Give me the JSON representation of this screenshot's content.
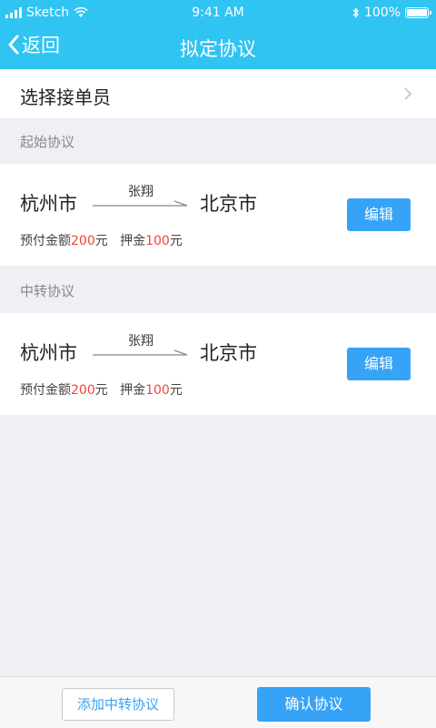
{
  "status_bar": {
    "carrier": "Sketch",
    "time": "9:41 AM",
    "battery": "100%"
  },
  "nav": {
    "back_label": "返回",
    "title": "拟定协议"
  },
  "select_row": {
    "label": "选择接单员"
  },
  "sections": [
    {
      "title": "起始协议",
      "from": "杭州市",
      "driver": "张翔",
      "to": "北京市",
      "prepaid_label": "预付金额",
      "prepaid_value": "200",
      "prepaid_unit": "元",
      "deposit_label": "押金",
      "deposit_value": "100",
      "deposit_unit": "元",
      "edit_label": "编辑"
    },
    {
      "title": "中转协议",
      "from": "杭州市",
      "driver": "张翔",
      "to": "北京市",
      "prepaid_label": "预付金额",
      "prepaid_value": "200",
      "prepaid_unit": "元",
      "deposit_label": "押金",
      "deposit_value": "100",
      "deposit_unit": "元",
      "edit_label": "编辑"
    }
  ],
  "footer": {
    "add_label": "添加中转协议",
    "confirm_label": "确认协议"
  },
  "colors": {
    "header": "#2fc4f2",
    "accent": "#36a3f7",
    "price_red": "#f2453c",
    "background": "#efeff4"
  },
  "icons": [
    "signal-icon",
    "wifi-icon",
    "bluetooth-icon",
    "battery-icon",
    "back-chevron-icon",
    "chevron-right-icon",
    "arrow-right-icon"
  ]
}
